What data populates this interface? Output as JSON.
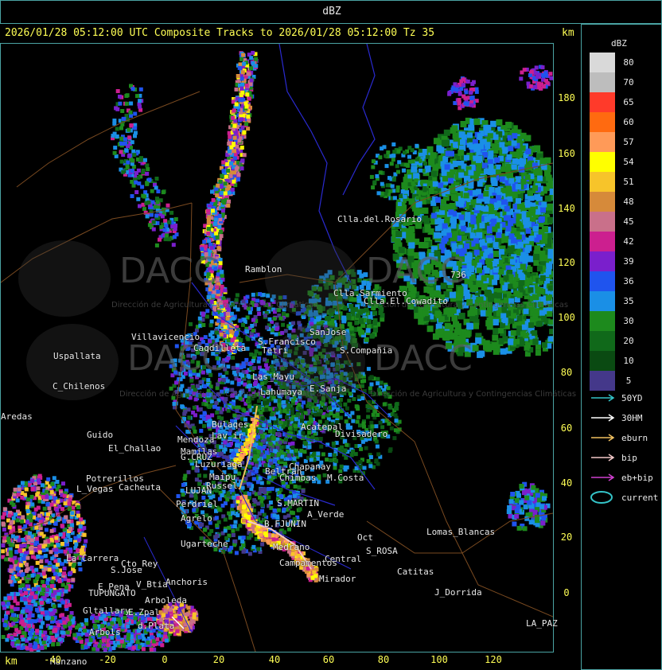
{
  "header": {
    "field": "dBZ",
    "subtitle": "2026/01/28 05:12:00 UTC Composite Tracks to 2026/01/28 05:12:00 Tz 35",
    "km_label": "km"
  },
  "axes": {
    "x_label": "km",
    "x_ticks": [
      "-40",
      "-20",
      "0",
      "20",
      "40",
      "60",
      "80",
      "100",
      "120"
    ],
    "y_ticks": [
      "180",
      "160",
      "140",
      "120",
      "100",
      "80",
      "60",
      "40",
      "20",
      "0"
    ]
  },
  "legend": {
    "title": "dBZ",
    "levels": [
      {
        "label": "80",
        "color": "#d9d9d9"
      },
      {
        "label": "70",
        "color": "#bdbdbd"
      },
      {
        "label": "65",
        "color": "#ff3a2a"
      },
      {
        "label": "60",
        "color": "#ff6a10"
      },
      {
        "label": "57",
        "color": "#ff9a58"
      },
      {
        "label": "54",
        "color": "#ffff00"
      },
      {
        "label": "51",
        "color": "#f7c42a"
      },
      {
        "label": "48",
        "color": "#d68a3a"
      },
      {
        "label": "45",
        "color": "#c9708a"
      },
      {
        "label": "42",
        "color": "#cc1f8f"
      },
      {
        "label": "39",
        "color": "#7a1fcc"
      },
      {
        "label": "36",
        "color": "#1f54ee"
      },
      {
        "label": "35",
        "color": "#1a8fe6"
      },
      {
        "label": "30",
        "color": "#1d8a1d"
      },
      {
        "label": "20",
        "color": "#10691a"
      },
      {
        "label": "10",
        "color": "#0a4a12"
      },
      {
        "label": "5",
        "color": "#44388a"
      }
    ],
    "tracks": [
      {
        "label": "50YD",
        "color": "#34c4c8"
      },
      {
        "label": "30HM",
        "color": "#ffffff"
      },
      {
        "label": "eburn",
        "color": "#f0c060"
      },
      {
        "label": "bip",
        "color": "#f2c8c8"
      },
      {
        "label": "eb+bip",
        "color": "#d040d0"
      },
      {
        "label": "current",
        "color": "#34c4c8"
      }
    ]
  },
  "map": {
    "places": [
      "Clla.del.Rosario",
      "Ramblon",
      "Clla.Sarmiento",
      "Clla.El.Cowadito",
      "Villavicencio",
      "Uspallata",
      "C_Chilenos",
      "Caqdilleta",
      "S.Francisco",
      "Tetri",
      "SanJose",
      "S.Compañia",
      "Las_Mayu",
      "Lahumaya",
      "E.Sanja",
      "Bulaqes",
      "Acatepal",
      "Lav_ir",
      "Mendoza",
      "Divisadero",
      "Mamilas",
      "Maipu",
      "G.CRUZ",
      "LUJAN",
      "Luzuriaga",
      "Beltran",
      "Chimbas",
      "Chapanay",
      "M.Costa",
      "S.MARTIN",
      "A_Verde",
      "Russel",
      "Perdriel",
      "Agrelo",
      "Ugarteche",
      "B.FJUNIN",
      "Medrano",
      "LA_PAZ",
      "Lomas_Blancas",
      "S_ROSA",
      "Catitas",
      "Central",
      "Campamentos",
      "Mirador",
      "J_Dorrida",
      "La_Carrera",
      "Cto_Rey",
      "S.Jose",
      "TUPUNGATO",
      "E_Pena",
      "V_Btia",
      "Anchoris",
      "Arboleda",
      "Gltallary",
      "E.Zpal",
      "Arbols",
      "d.Plata",
      "Manzano",
      "Guido",
      "El_Challao",
      "Potrerillos",
      "Cacheuta",
      "L_Vegas",
      "Aredas",
      "736",
      "Oct"
    ],
    "watermark": "DACC",
    "watermark_sub": "Dirección de Agricultura y Contingencias Climáticas"
  }
}
